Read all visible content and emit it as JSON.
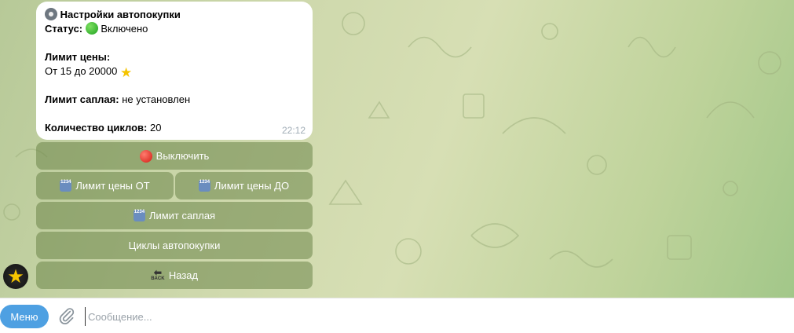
{
  "message": {
    "title": "Настройки автопокупки",
    "status_label": "Статус:",
    "status_value": "Включено",
    "price_limit_label": "Лимит цены:",
    "price_limit_value": "От 15 до 20000",
    "saplay_limit_label": "Лимит саплая:",
    "saplay_limit_value": "не установлен",
    "cycles_label": "Количество циклов:",
    "cycles_value": "20",
    "time": "22:12"
  },
  "keyboard": {
    "disable": "Выключить",
    "price_from": "Лимит цены ОТ",
    "price_to": "Лимит цены ДО",
    "saplay_limit": "Лимит саплая",
    "cycles": "Циклы автопокупки",
    "back": "Назад"
  },
  "emoji": {
    "number_tiles": "1234",
    "back_arrow_caption": "BACK"
  },
  "composer": {
    "menu_label": "Меню",
    "placeholder": "Сообщение..."
  },
  "colors": {
    "menu_button": "#4ea0e2",
    "keyboard_button": "#6b8549",
    "status_on": "#1ea120",
    "disable_icon": "#d21b12"
  }
}
